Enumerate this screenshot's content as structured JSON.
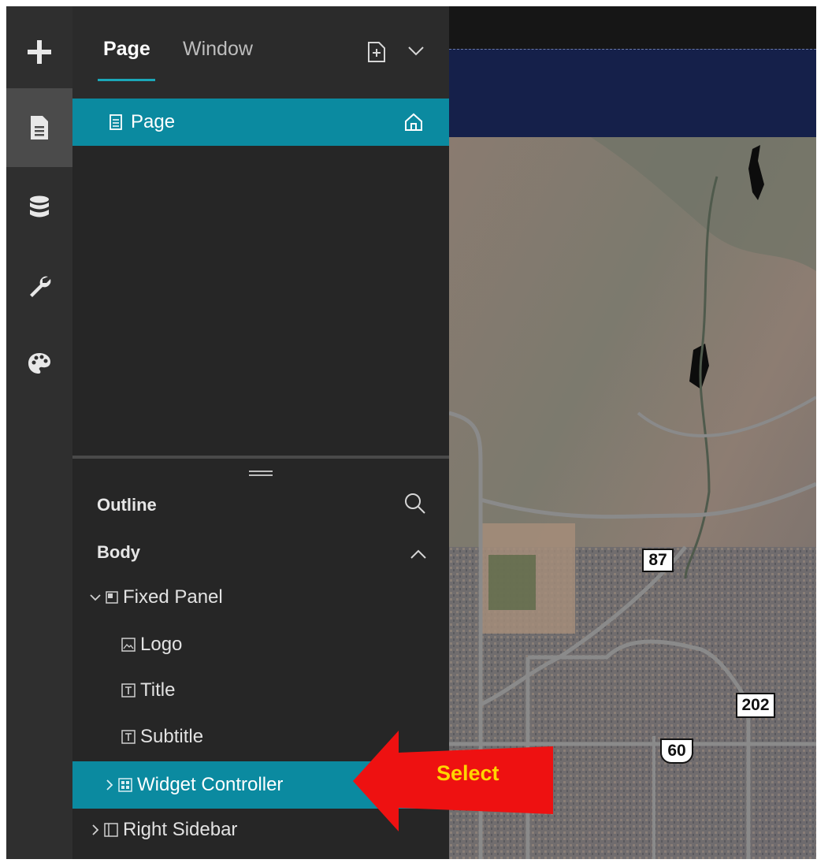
{
  "rail": {
    "items": [
      {
        "icon": "plus-icon"
      },
      {
        "icon": "page-icon",
        "active": true
      },
      {
        "icon": "database-icon"
      },
      {
        "icon": "wrench-icon"
      },
      {
        "icon": "palette-icon"
      }
    ]
  },
  "header": {
    "tabs": [
      {
        "label": "Page",
        "active": true
      },
      {
        "label": "Window",
        "active": false
      }
    ],
    "add_icon": "add-page-icon",
    "dropdown_icon": "chevron-down-icon"
  },
  "pages": {
    "items": [
      {
        "label": "Page",
        "home": true
      }
    ]
  },
  "outline": {
    "title": "Outline",
    "section": "Body",
    "items": [
      {
        "label": "Fixed Panel",
        "icon": "panel-icon",
        "expanded": true
      },
      {
        "label": "Logo",
        "icon": "image-icon"
      },
      {
        "label": "Title",
        "icon": "text-icon"
      },
      {
        "label": "Subtitle",
        "icon": "text-icon"
      },
      {
        "label": "Widget Controller",
        "icon": "widget-icon",
        "selected": true
      },
      {
        "label": "Right Sidebar",
        "icon": "sidebar-icon"
      }
    ]
  },
  "map": {
    "shields": [
      "87",
      "202",
      "60"
    ]
  },
  "annotation": {
    "label": "Select"
  },
  "colors": {
    "accent": "#0b8aa0",
    "arrow": "#ee1111",
    "callout_text": "#ffd500"
  }
}
